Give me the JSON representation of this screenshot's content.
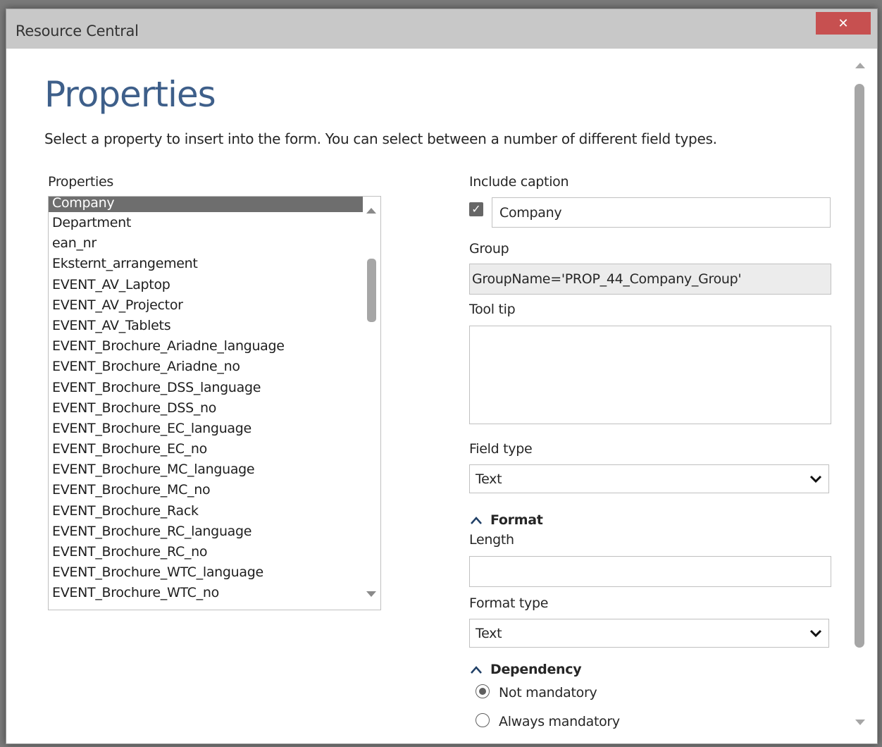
{
  "window": {
    "title": "Resource Central",
    "close_glyph": "✕"
  },
  "page": {
    "title": "Properties",
    "subtitle": "Select a property to insert into the form. You can select between a number of different field types."
  },
  "properties_list": {
    "label": "Properties",
    "selected_index": 0,
    "items": [
      "Company",
      "Department",
      "ean_nr",
      "Eksternt_arrangement",
      "EVENT_AV_Laptop",
      "EVENT_AV_Projector",
      "EVENT_AV_Tablets",
      "EVENT_Brochure_Ariadne_language",
      "EVENT_Brochure_Ariadne_no",
      "EVENT_Brochure_DSS_language",
      "EVENT_Brochure_DSS_no",
      "EVENT_Brochure_EC_language",
      "EVENT_Brochure_EC_no",
      "EVENT_Brochure_MC_language",
      "EVENT_Brochure_MC_no",
      "EVENT_Brochure_Rack",
      "EVENT_Brochure_RC_language",
      "EVENT_Brochure_RC_no",
      "EVENT_Brochure_WTC_language",
      "EVENT_Brochure_WTC_no"
    ]
  },
  "form": {
    "include_caption": {
      "label": "Include caption",
      "checked": true,
      "value": "Company"
    },
    "group": {
      "label": "Group",
      "value": "GroupName='PROP_44_Company_Group'"
    },
    "tool_tip": {
      "label": "Tool tip",
      "value": ""
    },
    "field_type": {
      "label": "Field type",
      "value": "Text"
    },
    "format": {
      "header": "Format",
      "length_label": "Length",
      "length_value": "",
      "format_type_label": "Format type",
      "format_type_value": "Text"
    },
    "dependency": {
      "header": "Dependency",
      "options": [
        {
          "label": "Not mandatory",
          "checked": true
        },
        {
          "label": "Always mandatory",
          "checked": false
        }
      ]
    }
  },
  "icons": {
    "checkbox": "check-icon",
    "dropdown": "chevron-down-icon",
    "section_toggle": "chevron-up-icon"
  }
}
